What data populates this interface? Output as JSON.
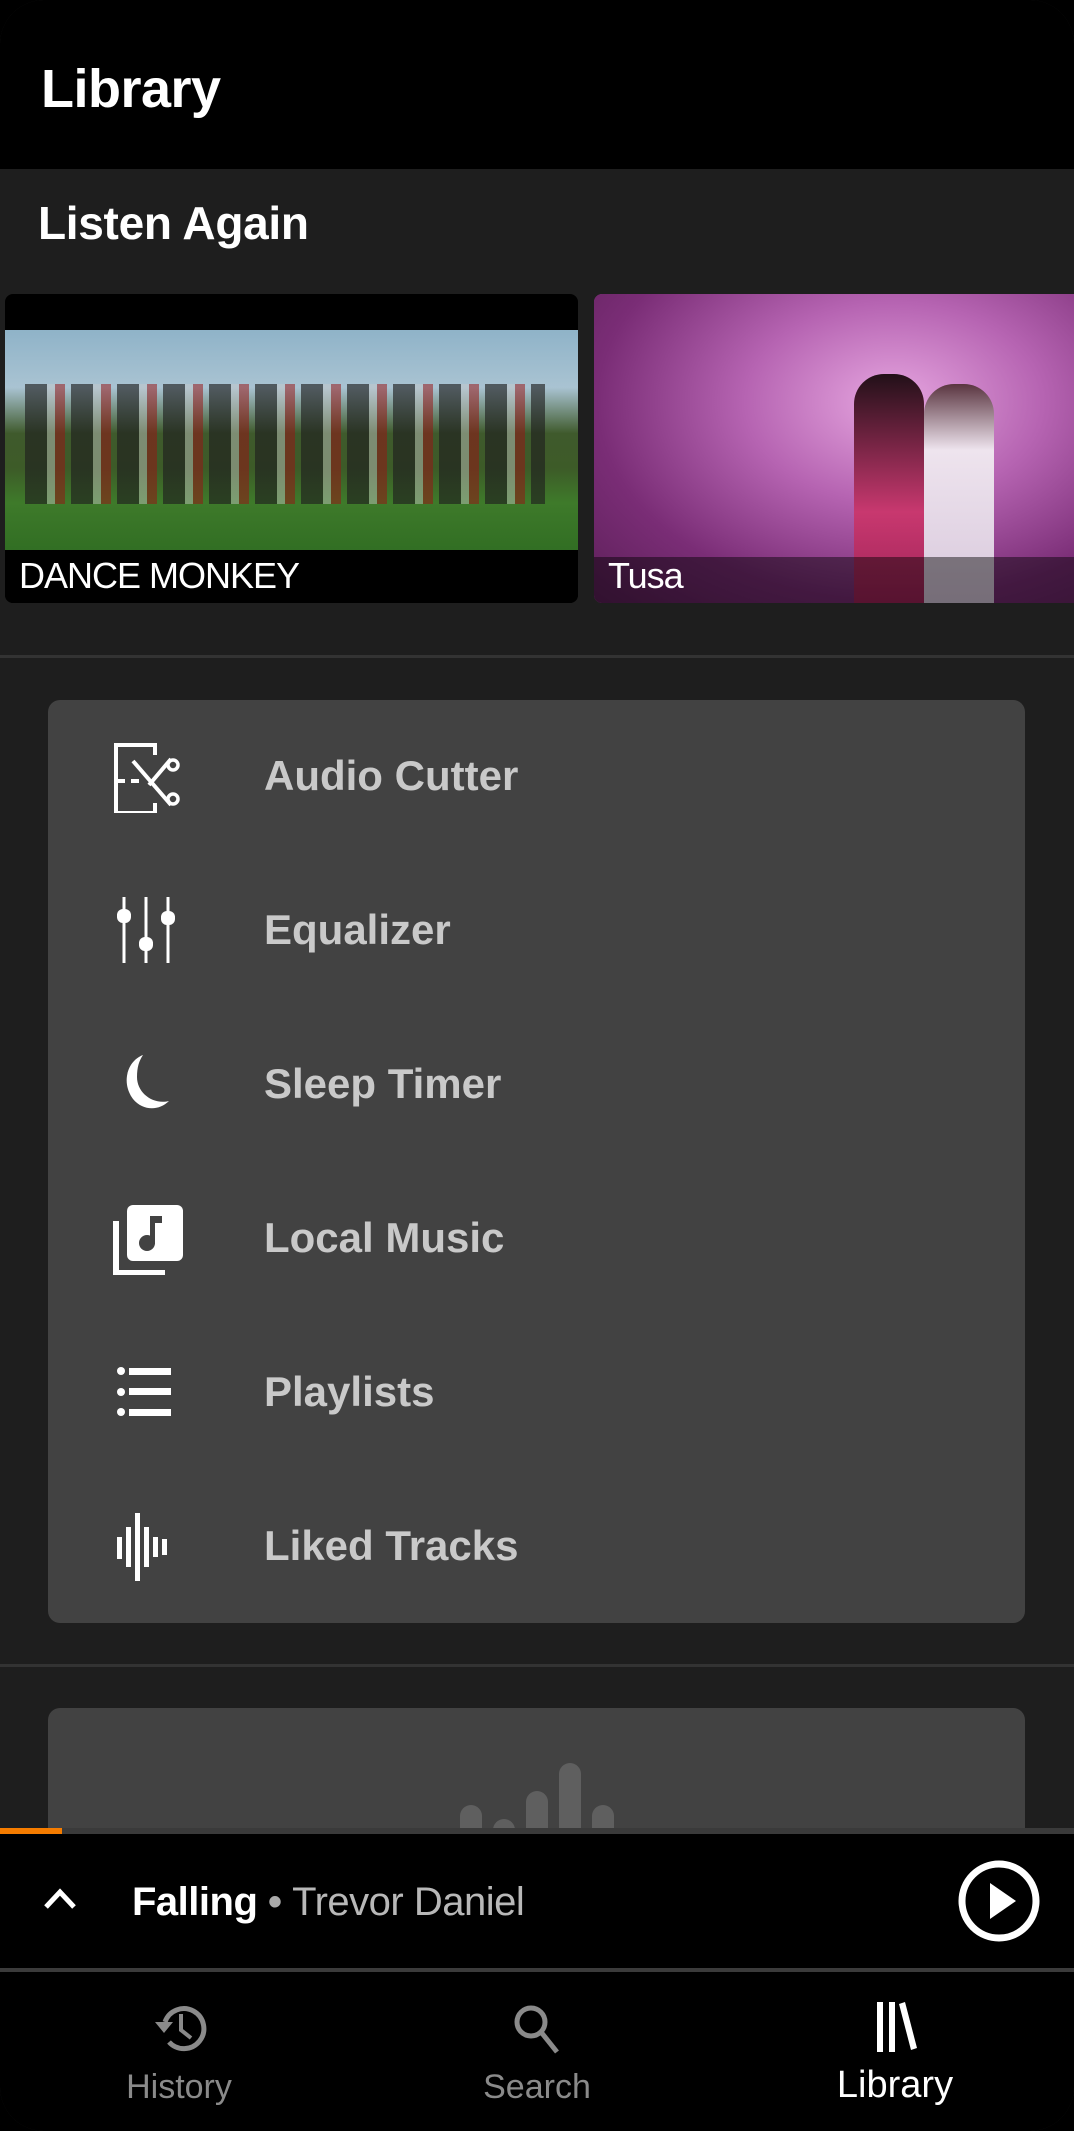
{
  "header": {
    "title": "Library"
  },
  "listen_again": {
    "title": "Listen Again",
    "items": [
      {
        "title": "DANCE MONKEY"
      },
      {
        "title": "Tusa"
      }
    ]
  },
  "menu": {
    "items": [
      {
        "label": "Audio Cutter",
        "icon": "audio-cutter-icon"
      },
      {
        "label": "Equalizer",
        "icon": "equalizer-icon"
      },
      {
        "label": "Sleep Timer",
        "icon": "moon-icon"
      },
      {
        "label": "Local Music",
        "icon": "local-music-icon"
      },
      {
        "label": "Playlists",
        "icon": "list-icon"
      },
      {
        "label": "Liked Tracks",
        "icon": "waveform-icon"
      }
    ]
  },
  "player": {
    "title": "Falling",
    "separator": " • ",
    "artist": "Trevor Daniel",
    "progress_percent": 5.8,
    "accent_color": "#f57c00"
  },
  "bottom_nav": {
    "items": [
      {
        "label": "History",
        "icon": "history-icon",
        "active": false
      },
      {
        "label": "Search",
        "icon": "search-icon",
        "active": false
      },
      {
        "label": "Library",
        "icon": "library-icon",
        "active": true
      }
    ]
  }
}
